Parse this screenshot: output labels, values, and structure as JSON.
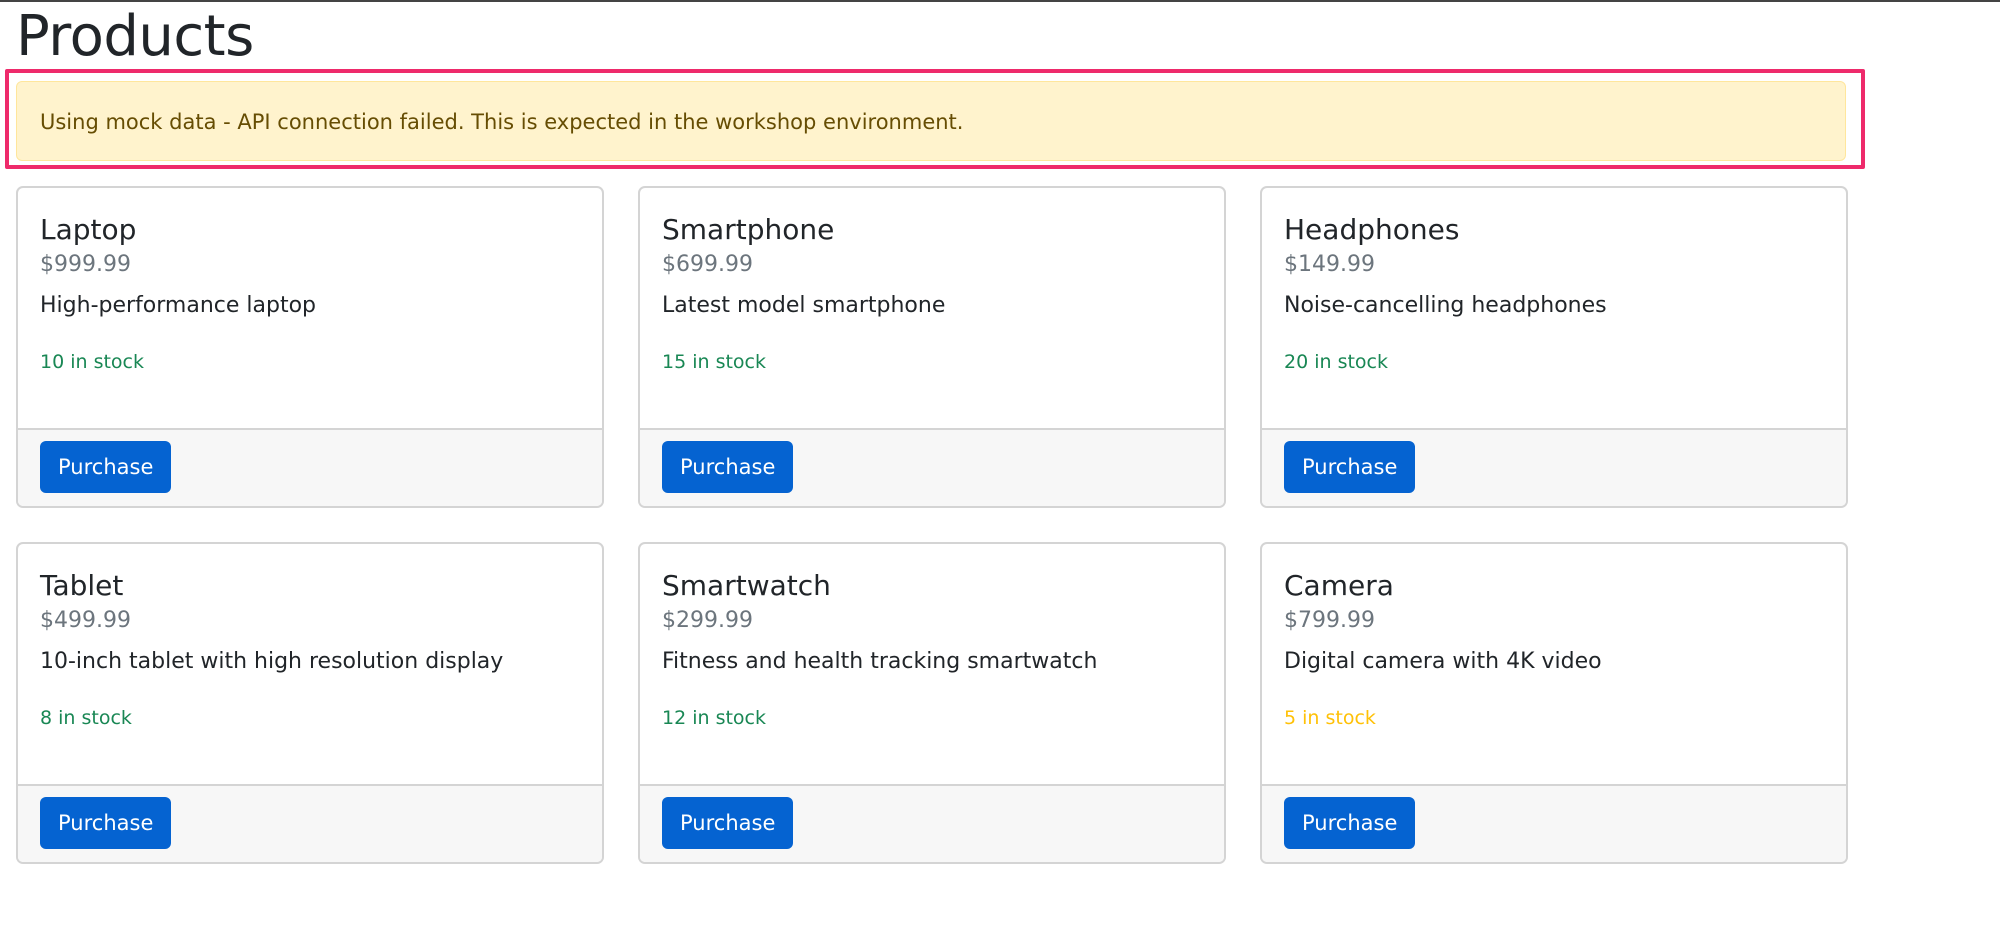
{
  "page": {
    "title": "Products"
  },
  "alert": {
    "message": "Using mock data - API connection failed. This is expected in the workshop environment."
  },
  "colors": {
    "in_stock": "#198754",
    "low_stock": "#ffc107",
    "highlight": "#ee2a6b",
    "button": "#0563d1",
    "alert_bg": "#fff3cd"
  },
  "products": [
    {
      "name": "Laptop",
      "price": "$999.99",
      "description": "High-performance laptop",
      "stock": "10 in stock",
      "stock_level": "normal",
      "button": "Purchase"
    },
    {
      "name": "Smartphone",
      "price": "$699.99",
      "description": "Latest model smartphone",
      "stock": "15 in stock",
      "stock_level": "normal",
      "button": "Purchase"
    },
    {
      "name": "Headphones",
      "price": "$149.99",
      "description": "Noise-cancelling headphones",
      "stock": "20 in stock",
      "stock_level": "normal",
      "button": "Purchase"
    },
    {
      "name": "Tablet",
      "price": "$499.99",
      "description": "10-inch tablet with high resolution display",
      "stock": "8 in stock",
      "stock_level": "normal",
      "button": "Purchase"
    },
    {
      "name": "Smartwatch",
      "price": "$299.99",
      "description": "Fitness and health tracking smartwatch",
      "stock": "12 in stock",
      "stock_level": "normal",
      "button": "Purchase"
    },
    {
      "name": "Camera",
      "price": "$799.99",
      "description": "Digital camera with 4K video",
      "stock": "5 in stock",
      "stock_level": "low",
      "button": "Purchase"
    }
  ]
}
